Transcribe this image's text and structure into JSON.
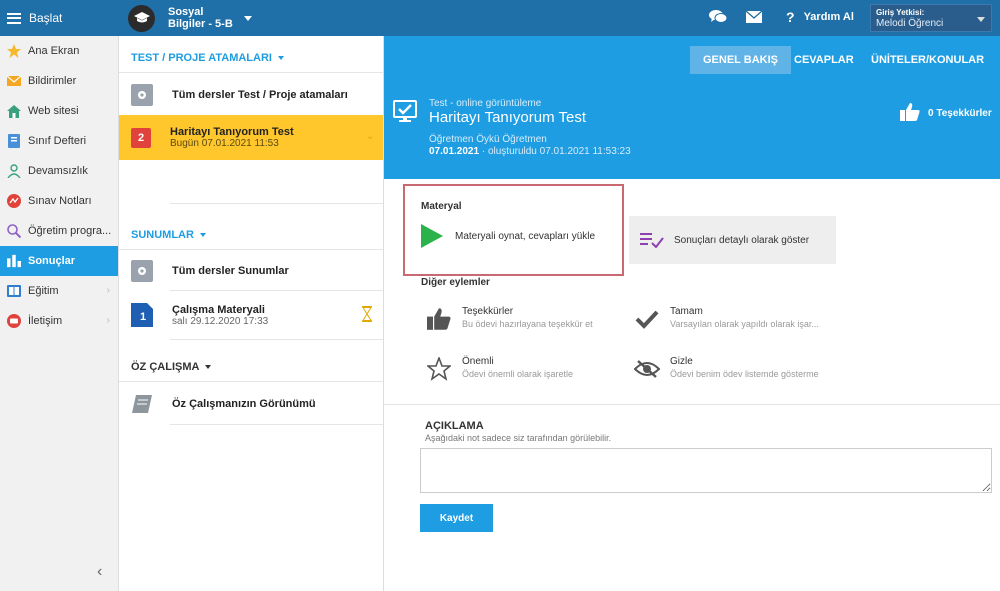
{
  "topbar": {
    "menu_label": "Başlat",
    "class_line1": "Sosyal",
    "class_line2": "Bilgiler - 5-B",
    "help_label": "Yardım Al",
    "user_label": "Giriş Yetkisi:",
    "user_name": "Melodi Öğrenci"
  },
  "sidebar": {
    "items": [
      {
        "label": "Ana Ekran",
        "icon": "star-icon"
      },
      {
        "label": "Bildirimler",
        "icon": "envelope-icon"
      },
      {
        "label": "Web sitesi",
        "icon": "home-icon"
      },
      {
        "label": "Sınıf Defteri",
        "icon": "notebook-icon"
      },
      {
        "label": "Devamsızlık",
        "icon": "person-icon"
      },
      {
        "label": "Sınav Notları",
        "icon": "chart-icon"
      },
      {
        "label": "Öğretim progra...",
        "icon": "search-icon"
      },
      {
        "label": "Sonuçlar",
        "icon": "bar-chart-icon"
      },
      {
        "label": "Eğitim",
        "icon": "book-icon"
      },
      {
        "label": "İletişim",
        "icon": "chat-icon"
      }
    ]
  },
  "middle": {
    "assignments_header": "TEST / PROJE ATAMALARI",
    "all_tests": "Tüm dersler Test / Proje atamaları",
    "active_test": {
      "badge": "2",
      "title": "Haritayı Tanıyorum Test",
      "date": "Bugün 07.01.2021 11:53"
    },
    "presentations_header": "SUNUMLAR",
    "all_presentations": "Tüm dersler Sunumlar",
    "material": {
      "badge": "1",
      "title": "Çalışma Materyali",
      "date": "salı 29.12.2020 17:33"
    },
    "self_study_header": "ÖZ ÇALIŞMA",
    "self_study_view": "Öz Çalışmanızın Görünümü"
  },
  "main": {
    "tabs": [
      "GENEL BAKIŞ",
      "CEVAPLAR",
      "ÜNİTELER/KONULAR"
    ],
    "header": {
      "subtitle": "Test - online görüntüleme",
      "title": "Haritayı Tanıyorum Test",
      "teacher": "Öğretmen Öykü Öğretmen",
      "date": "07.01.2021",
      "created": " · oluşturuldu 07.01.2021 11:53:23",
      "thanks": "0 Teşekkürler"
    },
    "material_label": "Materyal",
    "play_label": "Materyali oynat, cevapları yükle",
    "details_label": "Sonuçları detaylı olarak göster",
    "other_actions": "Diğer eylemler",
    "actions": [
      {
        "title": "Teşekkürler",
        "desc": "Bu ödevi hazırlayana teşekkür et"
      },
      {
        "title": "Tamam",
        "desc": "Varsayılan olarak yapıldı olarak işar..."
      },
      {
        "title": "Önemli",
        "desc": "Ödevi önemli olarak işaretle"
      },
      {
        "title": "Gizle",
        "desc": "Ödevi benim ödev listemde gösterme"
      }
    ],
    "description_title": "AÇIKLAMA",
    "description_sub": "Aşağıdaki not sadece siz tarafından görülebilir.",
    "description_value": "",
    "save_label": "Kaydet"
  },
  "colors": {
    "topbar": "#1f6fa8",
    "accent": "#1e9de2",
    "active_item": "#ffc72c",
    "highlight_border": "#c96a73"
  }
}
